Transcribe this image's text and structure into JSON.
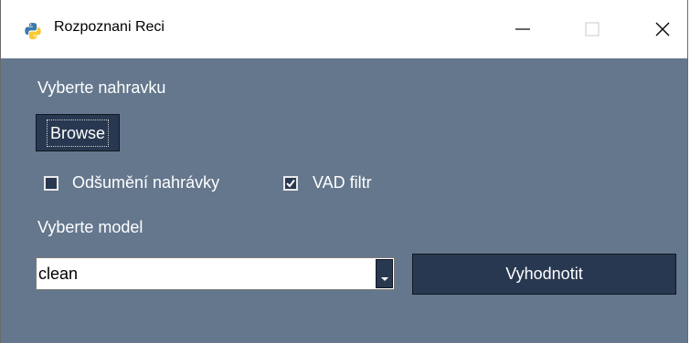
{
  "window": {
    "title": "Rozpoznani Reci",
    "icon": "python-icon"
  },
  "form": {
    "recording_label": "Vyberte nahravku",
    "browse_label": "Browse",
    "denoise_label": "Odšumění nahrávky",
    "denoise_checked": false,
    "vad_label": "VAD filtr",
    "vad_checked": true,
    "model_label": "Vyberte model",
    "model_value": "clean",
    "evaluate_label": "Vyhodnotit"
  },
  "colors": {
    "background": "#64778d",
    "button": "#283850",
    "text": "#ffffff"
  }
}
